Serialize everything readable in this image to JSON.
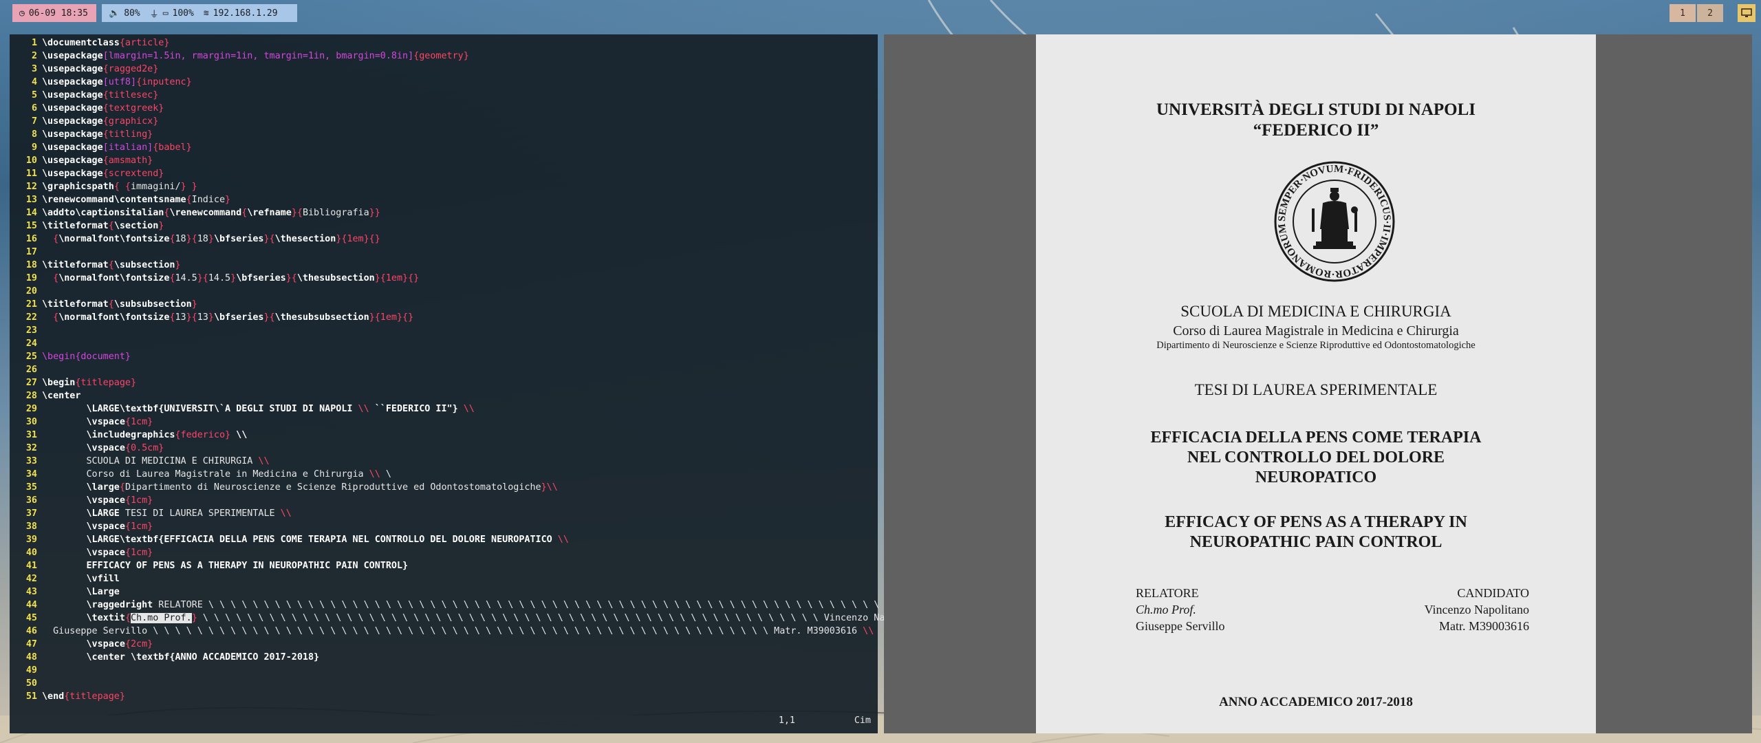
{
  "topbar": {
    "clock": "06-09 18:35",
    "volume": "80%",
    "battery": "100%",
    "ip": "192.168.1.29",
    "workspaces": [
      "1",
      "2"
    ],
    "colors": {
      "clock_bg": "#e8a3b5",
      "net_bg": "#a8c7e8",
      "workspace_bg": "#d7b79f",
      "system_button": "#e8c76a"
    }
  },
  "editor": {
    "lines": [
      [
        [
          "cmd",
          "\\documentclass"
        ],
        [
          "arg",
          "{article}"
        ]
      ],
      [
        [
          "cmd",
          "\\usepackage"
        ],
        [
          "argm",
          "[lmargin=1.5in, rmargin=1in, tmargin=1in, bmargin=0.8in]"
        ],
        [
          "arg",
          "{geometry}"
        ]
      ],
      [
        [
          "cmd",
          "\\usepackage"
        ],
        [
          "arg",
          "{ragged2e}"
        ]
      ],
      [
        [
          "cmd",
          "\\usepackage"
        ],
        [
          "argm",
          "[utf8]"
        ],
        [
          "arg",
          "{inputenc}"
        ]
      ],
      [
        [
          "cmd",
          "\\usepackage"
        ],
        [
          "arg",
          "{titlesec}"
        ]
      ],
      [
        [
          "cmd",
          "\\usepackage"
        ],
        [
          "arg",
          "{textgreek}"
        ]
      ],
      [
        [
          "cmd",
          "\\usepackage"
        ],
        [
          "arg",
          "{graphicx}"
        ]
      ],
      [
        [
          "cmd",
          "\\usepackage"
        ],
        [
          "arg",
          "{titling}"
        ]
      ],
      [
        [
          "cmd",
          "\\usepackage"
        ],
        [
          "argm",
          "[italian]"
        ],
        [
          "arg",
          "{babel}"
        ]
      ],
      [
        [
          "cmd",
          "\\usepackage"
        ],
        [
          "arg",
          "{amsmath}"
        ]
      ],
      [
        [
          "cmd",
          "\\usepackage"
        ],
        [
          "arg",
          "{scrextend}"
        ]
      ],
      [
        [
          "cmd",
          "\\graphicspath"
        ],
        [
          "arg",
          "{ {"
        ],
        [
          "txt",
          "immagini/"
        ],
        [
          "arg",
          "} }"
        ]
      ],
      [
        [
          "cmd",
          "\\renewcommand\\contentsname"
        ],
        [
          "arg",
          "{"
        ],
        [
          "txt",
          "Indice"
        ],
        [
          "arg",
          "}"
        ]
      ],
      [
        [
          "cmd",
          "\\addto\\captionsitalian"
        ],
        [
          "arg",
          "{"
        ],
        [
          "cmd",
          "\\renewcommand"
        ],
        [
          "arg",
          "{"
        ],
        [
          "cmd",
          "\\refname"
        ],
        [
          "arg",
          "}{"
        ],
        [
          "txt",
          "Bibliografia"
        ],
        [
          "arg",
          "}}"
        ]
      ],
      [
        [
          "cmd",
          "\\titleformat"
        ],
        [
          "arg",
          "{"
        ],
        [
          "cmd",
          "\\section"
        ],
        [
          "arg",
          "}"
        ]
      ],
      [
        [
          "txt",
          "  "
        ],
        [
          "arg",
          "{"
        ],
        [
          "cmd",
          "\\normalfont\\fontsize"
        ],
        [
          "arg",
          "{"
        ],
        [
          "txt",
          "18"
        ],
        [
          "arg",
          "}{"
        ],
        [
          "txt",
          "18"
        ],
        [
          "arg",
          "}"
        ],
        [
          "cmd",
          "\\bfseries"
        ],
        [
          "arg",
          "}{"
        ],
        [
          "cmd",
          "\\thesection"
        ],
        [
          "arg",
          "}{1em}{}"
        ]
      ],
      [],
      [
        [
          "cmd",
          "\\titleformat"
        ],
        [
          "arg",
          "{"
        ],
        [
          "cmd",
          "\\subsection"
        ],
        [
          "arg",
          "}"
        ]
      ],
      [
        [
          "txt",
          "  "
        ],
        [
          "arg",
          "{"
        ],
        [
          "cmd",
          "\\normalfont\\fontsize"
        ],
        [
          "arg",
          "{"
        ],
        [
          "txt",
          "14.5"
        ],
        [
          "arg",
          "}{"
        ],
        [
          "txt",
          "14.5"
        ],
        [
          "arg",
          "}"
        ],
        [
          "cmd",
          "\\bfseries"
        ],
        [
          "arg",
          "}{"
        ],
        [
          "cmd",
          "\\thesubsection"
        ],
        [
          "arg",
          "}{1em}{}"
        ]
      ],
      [],
      [
        [
          "cmd",
          "\\titleformat"
        ],
        [
          "arg",
          "{"
        ],
        [
          "cmd",
          "\\subsubsection"
        ],
        [
          "arg",
          "}"
        ]
      ],
      [
        [
          "txt",
          "  "
        ],
        [
          "arg",
          "{"
        ],
        [
          "cmd",
          "\\normalfont\\fontsize"
        ],
        [
          "arg",
          "{"
        ],
        [
          "txt",
          "13"
        ],
        [
          "arg",
          "}{"
        ],
        [
          "txt",
          "13"
        ],
        [
          "arg",
          "}"
        ],
        [
          "cmd",
          "\\bfseries"
        ],
        [
          "arg",
          "}{"
        ],
        [
          "cmd",
          "\\thesubsubsection"
        ],
        [
          "arg",
          "}{1em}{}"
        ]
      ],
      [],
      [],
      [
        [
          "argm",
          "\\begin{document}"
        ]
      ],
      [],
      [
        [
          "cmd",
          "\\begin"
        ],
        [
          "arg",
          "{titlepage}"
        ]
      ],
      [
        [
          "cmd",
          "\\center"
        ]
      ],
      [
        [
          "txt",
          "        "
        ],
        [
          "cmd",
          "\\LARGE\\textbf"
        ],
        [
          "cmd",
          "{UNIVERSIT\\`A DEGLI STUDI DI NAPOLI "
        ],
        [
          "arg",
          "\\\\"
        ],
        [
          "cmd",
          " ``FEDERICO II\"} "
        ],
        [
          "arg",
          "\\\\"
        ]
      ],
      [
        [
          "txt",
          "        "
        ],
        [
          "cmd",
          "\\vspace"
        ],
        [
          "arg",
          "{1cm}"
        ]
      ],
      [
        [
          "txt",
          "        "
        ],
        [
          "cmd",
          "\\includegraphics"
        ],
        [
          "arg",
          "{federico}"
        ],
        [
          "cmd",
          " \\\\"
        ]
      ],
      [
        [
          "txt",
          "        "
        ],
        [
          "cmd",
          "\\vspace"
        ],
        [
          "arg",
          "{0.5cm}"
        ]
      ],
      [
        [
          "txt",
          "        SCUOLA DI MEDICINA E CHIRURGIA "
        ],
        [
          "arg",
          "\\\\"
        ]
      ],
      [
        [
          "txt",
          "        Corso di Laurea Magistrale in Medicina e Chirurgia "
        ],
        [
          "arg",
          "\\\\"
        ],
        [
          "txt",
          " \\"
        ]
      ],
      [
        [
          "txt",
          "        "
        ],
        [
          "cmd",
          "\\large"
        ],
        [
          "arg",
          "{"
        ],
        [
          "txt",
          "Dipartimento di Neuroscienze e Scienze Riproduttive ed Odontostomatologiche"
        ],
        [
          "arg",
          "}\\\\"
        ]
      ],
      [
        [
          "txt",
          "        "
        ],
        [
          "cmd",
          "\\vspace"
        ],
        [
          "arg",
          "{1cm}"
        ]
      ],
      [
        [
          "txt",
          "        "
        ],
        [
          "cmd",
          "\\LARGE"
        ],
        [
          "txt",
          " TESI DI LAUREA SPERIMENTALE "
        ],
        [
          "arg",
          "\\\\"
        ]
      ],
      [
        [
          "txt",
          "        "
        ],
        [
          "cmd",
          "\\vspace"
        ],
        [
          "arg",
          "{1cm}"
        ]
      ],
      [
        [
          "txt",
          "        "
        ],
        [
          "cmd",
          "\\LARGE\\textbf{EFFICACIA DELLA PENS COME TERAPIA NEL CONTROLLO DEL DOLORE NEUROPATICO "
        ],
        [
          "arg",
          "\\\\"
        ]
      ],
      [
        [
          "txt",
          "        "
        ],
        [
          "cmd",
          "\\vspace"
        ],
        [
          "arg",
          "{1cm}"
        ]
      ],
      [
        [
          "txt",
          "        "
        ],
        [
          "cmd",
          "EFFICACY OF PENS AS A THERAPY IN NEUROPATHIC PAIN CONTROL}"
        ]
      ],
      [
        [
          "txt",
          "        "
        ],
        [
          "cmd",
          "\\vfill"
        ]
      ],
      [
        [
          "txt",
          "        "
        ],
        [
          "cmd",
          "\\Large"
        ]
      ],
      [
        [
          "txt",
          "        "
        ],
        [
          "cmd",
          "\\raggedright"
        ],
        [
          "txt",
          " RELATORE \\ \\ \\ \\ \\ \\ \\ \\ \\ \\ \\ \\ \\ \\ \\ \\ \\ \\ \\ \\ \\ \\ \\ \\ \\ \\ \\ \\ \\ \\ \\ \\ \\ \\ \\ \\ \\ \\ \\ \\ \\ \\ \\ \\ \\ \\ \\ \\ \\ \\ \\ \\ \\ \\ \\ \\ \\ \\ \\ \\ \\ \\ CANDIDATO"
        ]
      ],
      [
        [
          "txt",
          "        "
        ],
        [
          "cmd",
          "\\textit"
        ],
        [
          "arg",
          "{"
        ],
        [
          "sel",
          "Ch.mo Prof."
        ],
        [
          "arg",
          "}"
        ],
        [
          "txt",
          " \\ \\ \\ \\ \\ \\ \\ \\ \\ \\ \\ \\ \\ \\ \\ \\ \\ \\ \\ \\ \\ \\ \\ \\ \\ \\ \\ \\ \\ \\ \\ \\ \\ \\ \\ \\ \\ \\ \\ \\ \\ \\ \\ \\ \\ \\ \\ \\ \\ \\ \\ \\ \\ \\ \\ \\ Vincenzo Napolitano "
        ],
        [
          "arg",
          "\\\\"
        ]
      ],
      [
        [
          "txt",
          "  Giuseppe Servillo \\ \\ \\ \\ \\ \\ \\ \\ \\ \\ \\ \\ \\ \\ \\ \\ \\ \\ \\ \\ \\ \\ \\ \\ \\ \\ \\ \\ \\ \\ \\ \\ \\ \\ \\ \\ \\ \\ \\ \\ \\ \\ \\ \\ \\ \\ \\ \\ \\ \\ \\ \\ \\ \\ \\ \\ Matr. M39003616 "
        ],
        [
          "arg",
          "\\\\"
        ]
      ],
      [
        [
          "txt",
          "        "
        ],
        [
          "cmd",
          "\\vspace"
        ],
        [
          "arg",
          "{2cm}"
        ]
      ],
      [
        [
          "txt",
          "        "
        ],
        [
          "cmd",
          "\\center \\textbf{ANNO ACCADEMICO 2017-2018}"
        ]
      ],
      [],
      [],
      [
        [
          "cmd",
          "\\end"
        ],
        [
          "arg",
          "{titlepage}"
        ]
      ]
    ],
    "status_position": "1,1",
    "status_scroll": "Cim"
  },
  "pdf": {
    "university_line1": "UNIVERSITÀ DEGLI STUDI DI NAPOLI",
    "university_line2": "“FEDERICO II”",
    "school": "SCUOLA DI MEDICINA E CHIRURGIA",
    "course": "Corso di Laurea Magistrale in Medicina e Chirurgia",
    "department": "Dipartimento di Neuroscienze e Scienze Riproduttive ed Odontostomatologiche",
    "thesis_type": "TESI DI LAUREA SPERIMENTALE",
    "title_it": [
      "EFFICACIA DELLA PENS COME TERAPIA",
      "NEL CONTROLLO DEL DOLORE",
      "NEUROPATICO"
    ],
    "title_en": [
      "EFFICACY OF PENS AS A THERAPY IN",
      "NEUROPATHIC PAIN CONTROL"
    ],
    "relatore_label": "RELATORE",
    "relatore_title": "Ch.mo Prof.",
    "relatore_name": "Giuseppe Servillo",
    "candidato_label": "CANDIDATO",
    "candidato_name": "Vincenzo Napolitano",
    "candidato_matr": "Matr. M39003616",
    "academic_year": "ANNO ACCADEMICO 2017-2018",
    "seal_text": "SEMPER·NOVUM·FRIDERICUS·II·IMPERATOR·ROMANORUM"
  }
}
